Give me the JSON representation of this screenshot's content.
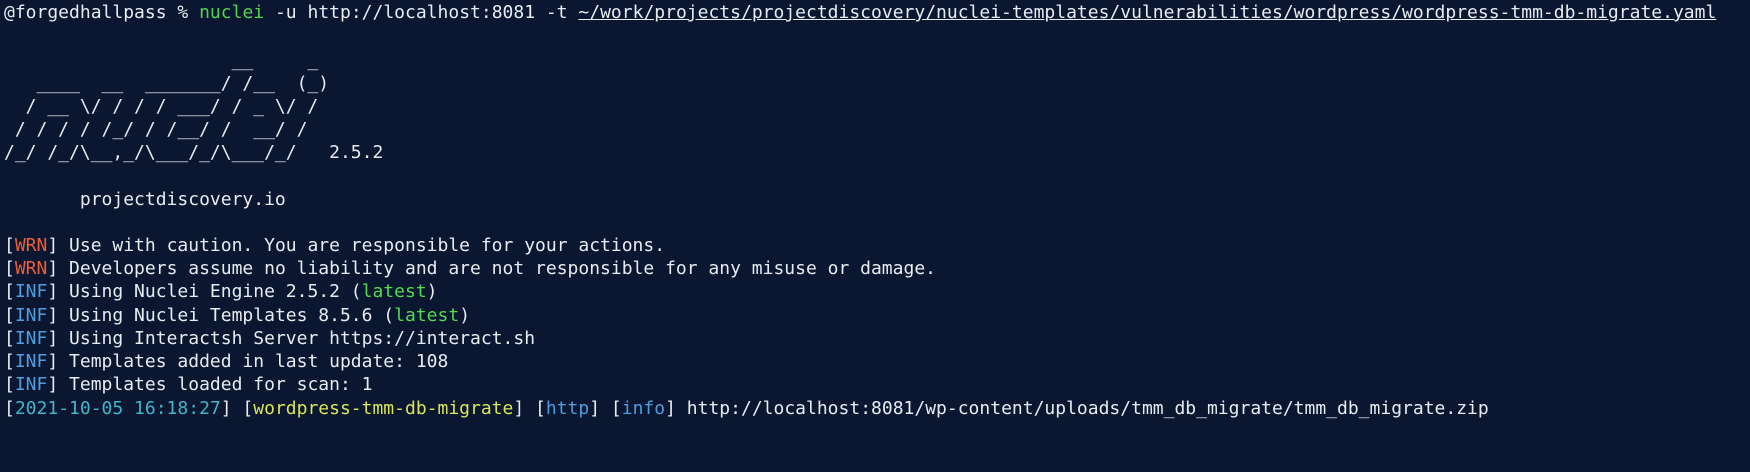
{
  "prompt": {
    "user": "@forgedhallpass",
    "symbol": "%",
    "command": "nuclei",
    "args": "-u http://localhost:8081 -t",
    "template_path": "~/work/projects/projectdiscovery/nuclei-templates/vulnerabilities/wordpress/wordpress-tmm-db-migrate.yaml"
  },
  "banner": {
    "lines": [
      "                     __     _",
      "   ____  __  _______/ /__  (_)",
      "  / __ \\/ / / / ___/ / _ \\/ /",
      " / / / / /_/ / /__/ /  __/ /",
      "/_/ /_/\\__,_/\\___/_/\\___/_/   2.5.2"
    ],
    "site": "       projectdiscovery.io"
  },
  "logs": [
    {
      "level": "WRN",
      "text": " Use with caution. You are responsible for your actions."
    },
    {
      "level": "WRN",
      "text": " Developers assume no liability and are not responsible for any misuse or damage."
    },
    {
      "level": "INF",
      "text": " Using Nuclei Engine 2.5.2 (",
      "highlight": "latest",
      "suffix": ")"
    },
    {
      "level": "INF",
      "text": " Using Nuclei Templates 8.5.6 (",
      "highlight": "latest",
      "suffix": ")"
    },
    {
      "level": "INF",
      "text": " Using Interactsh Server https://interact.sh"
    },
    {
      "level": "INF",
      "text": " Templates added in last update: 108"
    },
    {
      "level": "INF",
      "text": " Templates loaded for scan: 1"
    }
  ],
  "result": {
    "timestamp": "2021-10-05 16:18:27",
    "template_id": "wordpress-tmm-db-migrate",
    "protocol": "http",
    "severity": "info",
    "matched_url": "http://localhost:8081/wp-content/uploads/tmm_db_migrate/tmm_db_migrate.zip"
  },
  "colors": {
    "background": "#0b1630",
    "warn": "#e8603c",
    "info": "#4f9fe0",
    "green": "#4fdc4f",
    "timestamp": "#3fb6c9",
    "template": "#d9e65a"
  }
}
